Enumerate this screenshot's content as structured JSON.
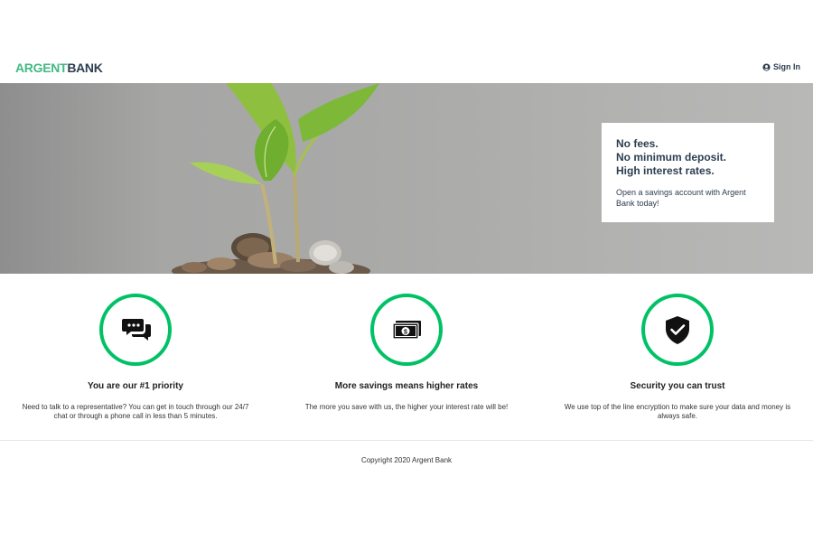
{
  "brand": {
    "part1": "ARGENT",
    "part2": "BANK"
  },
  "header": {
    "signin_label": "Sign In"
  },
  "hero": {
    "line1": "No fees.",
    "line2": "No minimum deposit.",
    "line3": "High interest rates.",
    "description": "Open a savings account with Argent Bank today!"
  },
  "features": [
    {
      "icon": "chat-icon",
      "title": "You are our #1 priority",
      "text": "Need to talk to a representative? You can get in touch through our 24/7 chat or through a phone call in less than 5 minutes."
    },
    {
      "icon": "money-icon",
      "title": "More savings means higher rates",
      "text": "The more you save with us, the higher your interest rate will be!"
    },
    {
      "icon": "security-icon",
      "title": "Security you can trust",
      "text": "We use top of the line encryption to make sure your data and money is always safe."
    }
  ],
  "footer": {
    "copyright": "Copyright 2020 Argent Bank"
  },
  "colors": {
    "brand_green": "#42b983",
    "circle_green": "#00c165",
    "text_dark": "#2c3e50"
  }
}
